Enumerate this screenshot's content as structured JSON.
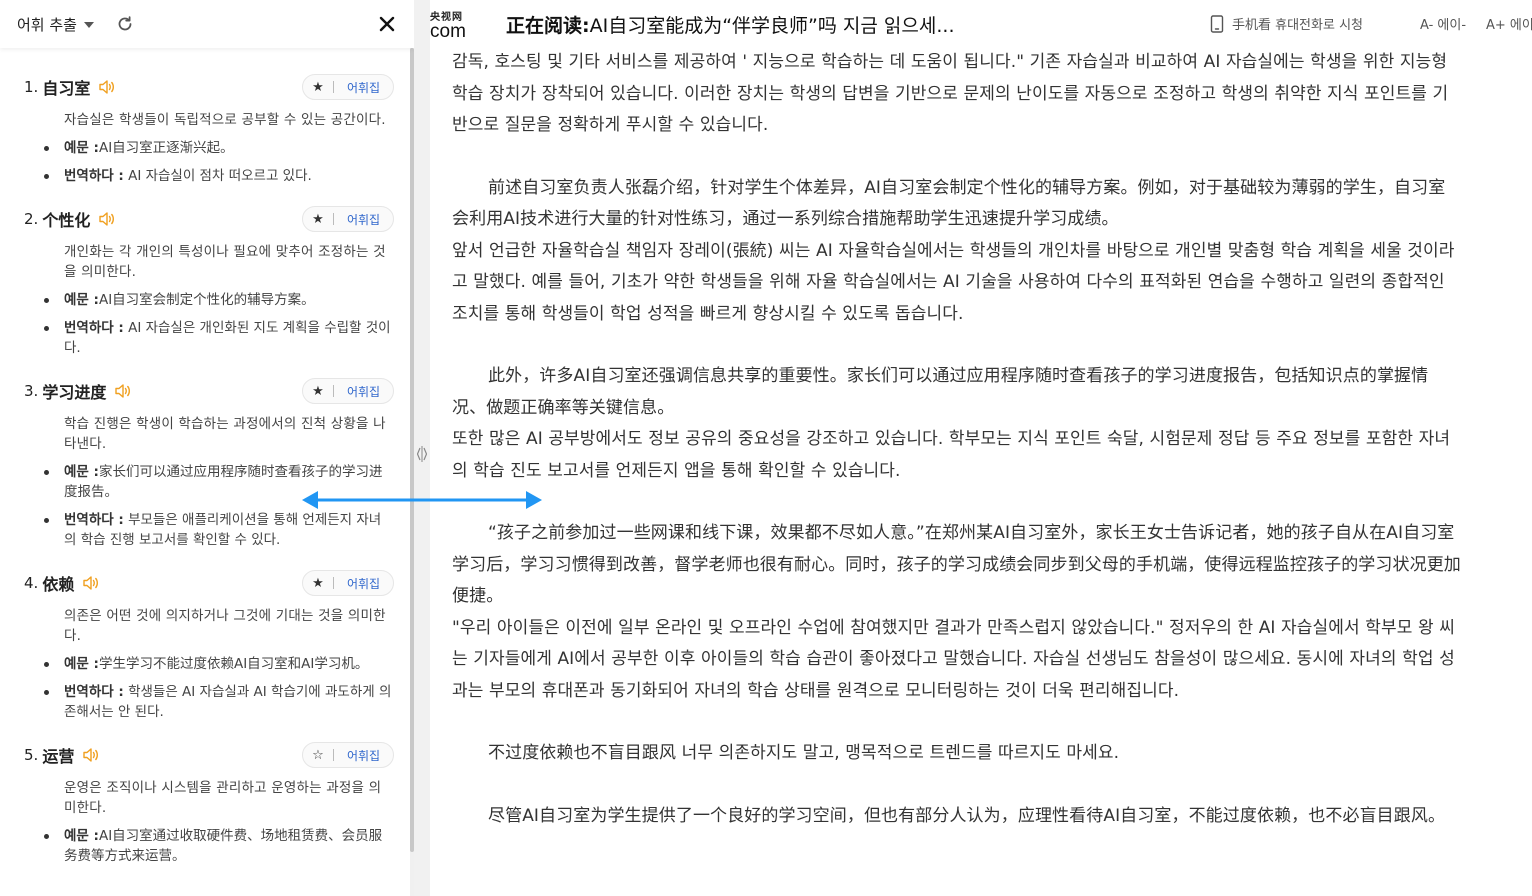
{
  "sidebar": {
    "title": "어휘 추출",
    "items": [
      {
        "num": "1.",
        "word": "自习室",
        "fav_label": "어휘집",
        "fav_starred": true,
        "definition": "자습실은 학생들이 독립적으로 공부할 수 있는 공간이다.",
        "example_label": "예문 :",
        "example": "AI自习室正逐渐兴起。",
        "translation_label": "번역하다 :",
        "translation": "AI 자습실이 점차 떠오르고 있다."
      },
      {
        "num": "2.",
        "word": "个性化",
        "fav_label": "어휘집",
        "fav_starred": true,
        "definition": "개인화는 각 개인의 특성이나 필요에 맞추어 조정하는 것을 의미한다.",
        "example_label": "예문 :",
        "example": "AI自习室会制定个性化的辅导方案。",
        "translation_label": "번역하다 :",
        "translation": "AI 자습실은 개인화된 지도 계획을 수립할 것이다."
      },
      {
        "num": "3.",
        "word": "学习进度",
        "fav_label": "어휘집",
        "fav_starred": true,
        "definition": "학습 진행은 학생이 학습하는 과정에서의 진척 상황을 나타낸다.",
        "example_label": "예문 :",
        "example": "家长们可以通过应用程序随时查看孩子的学习进度报告。",
        "translation_label": "번역하다 :",
        "translation": "부모들은 애플리케이션을 통해 언제든지 자녀의 학습 진행 보고서를 확인할 수 있다."
      },
      {
        "num": "4.",
        "word": "依赖",
        "fav_label": "어휘집",
        "fav_starred": true,
        "definition": "의존은 어떤 것에 의지하거나 그것에 기대는 것을 의미한다.",
        "example_label": "예문 :",
        "example": "学生学习不能过度依赖AI自习室和AI学习机。",
        "translation_label": "번역하다 :",
        "translation": "학생들은 AI 자습실과 AI 학습기에 과도하게 의존해서는 안 된다."
      },
      {
        "num": "5.",
        "word": "运营",
        "fav_label": "어휘집",
        "fav_starred": false,
        "definition": "운영은 조직이나 시스템을 관리하고 운영하는 과정을 의미한다.",
        "example_label": "예문 :",
        "example": "AI自习室通过收取硬件费、场地租赁费、会员服务费等方式来运营。",
        "translation_label": "",
        "translation": ""
      }
    ]
  },
  "topbar": {
    "logo_top": "央视网",
    "logo_bottom": "com",
    "reading_label": "正在阅读:",
    "reading_title": "AI自习室能成为“伴学良师”吗 지금 읽으세...",
    "mobile_watch": "手机看 휴대전화로 시청",
    "font_minus": "A- 에이-",
    "font_plus": "A+ 에이+"
  },
  "article": {
    "paragraphs": [
      {
        "type": "cont",
        "text": "감독, 호스팅 및 기타 서비스를 제공하여 ' 지능으로 학습하는 데 도움이 됩니다.\" 기존 자습실과 비교하여 AI 자습실에는 학생을 위한 지능형 학습 장치가 장착되어 있습니다. 이러한 장치는 학생의 답변을 기반으로 문제의 난이도를 자동으로 조정하고 학생의 취약한 지식 포인트를 기반으로 질문을 정확하게 푸시할 수 있습니다."
      },
      {
        "type": "zh",
        "text": "前述自习室负责人张磊介绍，针对学生个体差异，AI自习室会制定个性化的辅导方案。例如，对于基础较为薄弱的学生，自习室会利用AI技术进行大量的针对性练习，通过一系列综合措施帮助学生迅速提升学习成绩。"
      },
      {
        "type": "ko",
        "text": "앞서 언급한 자율학습실 책임자 장레이(張統) 씨는 AI 자율학습실에서는 학생들의 개인차를 바탕으로 개인별 맞춤형 학습 계획을 세울 것이라고 말했다. 예를 들어, 기초가 약한 학생들을 위해 자율 학습실에서는 AI 기술을 사용하여 다수의 표적화된 연습을 수행하고 일련의 종합적인 조치를 통해 학생들이 학업 성적을 빠르게 향상시킬 수 있도록 돕습니다."
      },
      {
        "type": "zh",
        "text": "此外，许多AI自习室还强调信息共享的重要性。家长们可以通过应用程序随时查看孩子的学习进度报告，包括知识点的掌握情况、做题正确率等关键信息。"
      },
      {
        "type": "ko",
        "text": "또한 많은 AI 공부방에서도 정보 공유의 중요성을 강조하고 있습니다. 학부모는 지식 포인트 숙달, 시험문제 정답 등 주요 정보를 포함한 자녀의 학습 진도 보고서를 언제든지 앱을 통해 확인할 수 있습니다."
      },
      {
        "type": "zh",
        "text": "“孩子之前参加过一些网课和线下课，效果都不尽如人意。”在郑州某AI自习室外，家长王女士告诉记者，她的孩子自从在AI自习室学习后，学习习惯得到改善，督学老师也很有耐心。同时，孩子的学习成绩会同步到父母的手机端，使得远程监控孩子的学习状况更加便捷。"
      },
      {
        "type": "ko",
        "text": "\"우리 아이들은 이전에 일부 온라인 및 오프라인 수업에 참여했지만 결과가 만족스럽지 않았습니다.\" 정저우의 한 AI 자습실에서 학부모 왕 씨는 기자들에게 AI에서 공부한 이후 아이들의 학습 습관이 좋아졌다고 말했습니다. 자습실 선생님도 참을성이 많으세요. 동시에 자녀의 학업 성과는 부모의 휴대폰과 동기화되어 자녀의 학습 상태를 원격으로 모니터링하는 것이 더욱 편리해집니다."
      },
      {
        "type": "zh",
        "text": "不过度依赖也不盲目跟风 너무 의존하지도 말고, 맹목적으로 트렌드를 따르지도 마세요."
      },
      {
        "type": "zh",
        "text": "尽管AI自习室为学生提供了一个良好的学习空间，但也有部分人认为，应理性看待AI自习室，不能过度依赖，也不必盲目跟风。"
      }
    ]
  },
  "colors": {
    "accent": "#2f66cc",
    "arrow": "#2196f3",
    "audio": "#f0a020"
  }
}
